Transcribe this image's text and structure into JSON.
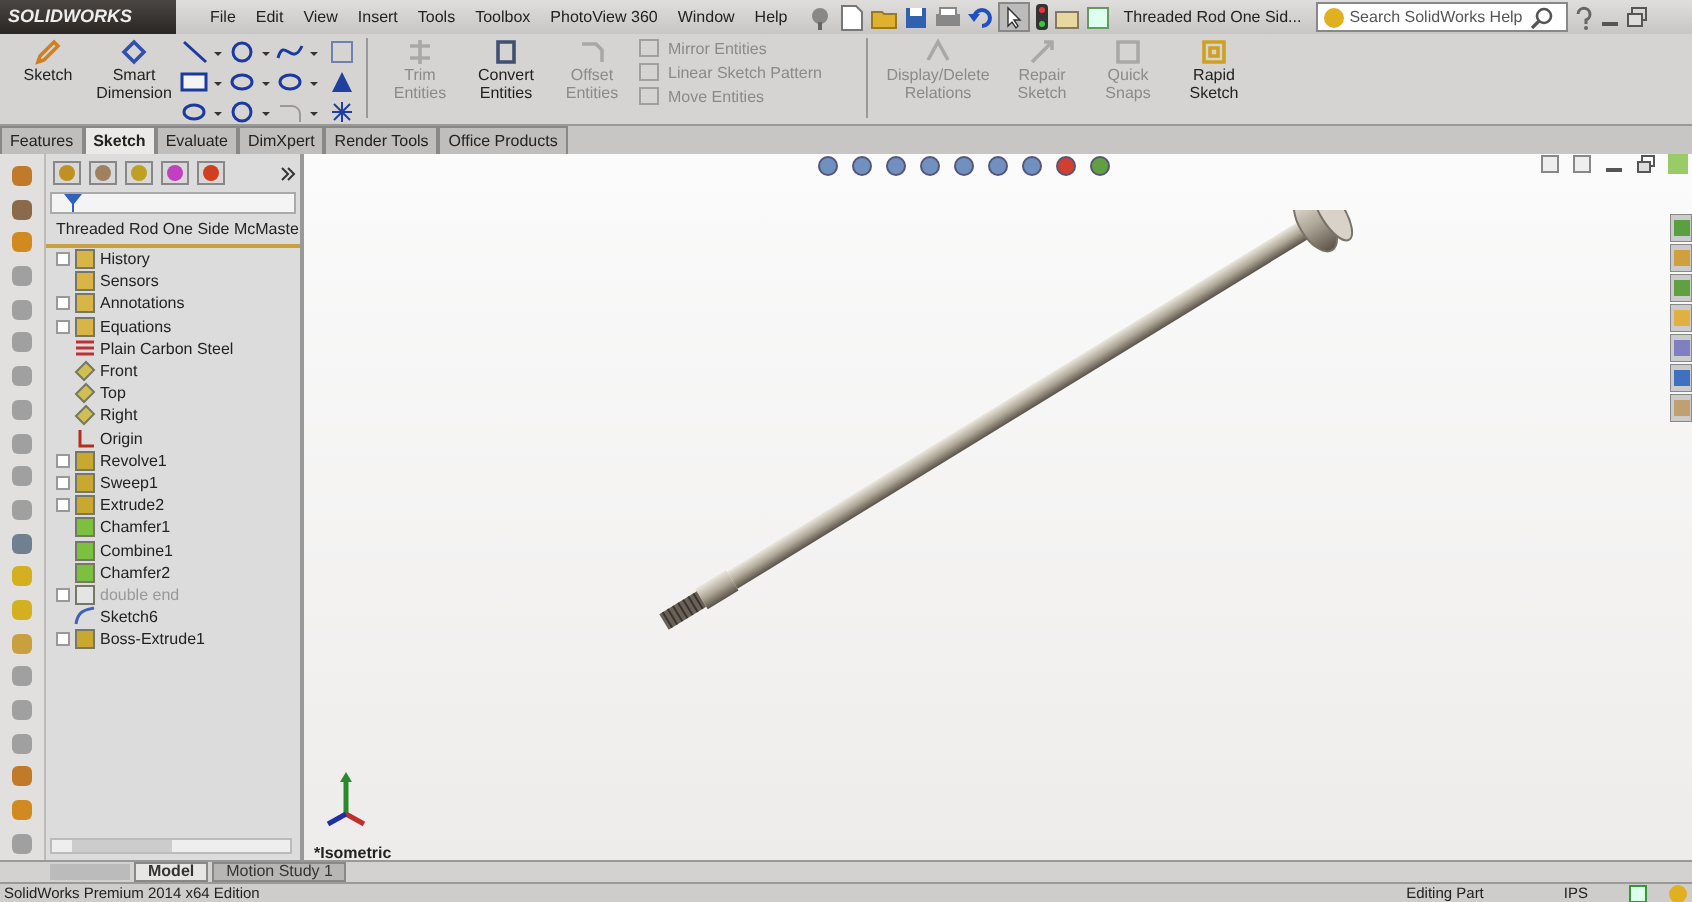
{
  "title_bar": {
    "logo": "SOLIDWORKS",
    "menu": [
      "File",
      "Edit",
      "View",
      "Insert",
      "Tools",
      "Toolbox",
      "PhotoView 360",
      "Window",
      "Help"
    ],
    "document_title": "Threaded Rod One Sid...",
    "search": {
      "placeholder": "Search SolidWorks Help"
    }
  },
  "command_manager": {
    "large_buttons": [
      {
        "label": "Sketch",
        "kind": "sketch",
        "disabled": false
      },
      {
        "label": "Smart Dimension",
        "kind": "dimension",
        "disabled": false
      }
    ],
    "entity_buttons": [
      {
        "label": "Trim Entities",
        "kind": "trim",
        "disabled": true
      },
      {
        "label": "Convert Entities",
        "kind": "convert",
        "disabled": false
      },
      {
        "label": "Offset Entities",
        "kind": "offset",
        "disabled": true
      }
    ],
    "small_buttons": [
      {
        "label": "Mirror Entities",
        "disabled": true
      },
      {
        "label": "Linear Sketch Pattern",
        "disabled": true
      },
      {
        "label": "Move Entities",
        "disabled": true
      }
    ],
    "right_buttons": [
      {
        "label": "Display/Delete Relations",
        "kind": "relations",
        "disabled": true
      },
      {
        "label": "Repair Sketch",
        "kind": "repair",
        "disabled": true
      },
      {
        "label": "Quick Snaps",
        "kind": "snaps",
        "disabled": true
      },
      {
        "label": "Rapid Sketch",
        "kind": "rapid",
        "disabled": false
      }
    ]
  },
  "tabs": [
    {
      "label": "Features",
      "selected": false
    },
    {
      "label": "Sketch",
      "selected": true
    },
    {
      "label": "Evaluate",
      "selected": false
    },
    {
      "label": "DimXpert",
      "selected": false
    },
    {
      "label": "Render Tools",
      "selected": false
    },
    {
      "label": "Office Products",
      "selected": false
    }
  ],
  "feature_tree": {
    "root": "Threaded Rod One Side McMaste",
    "items": [
      {
        "label": "History",
        "kind": "folder",
        "expandable": true,
        "suppressed": false
      },
      {
        "label": "Sensors",
        "kind": "folder",
        "expandable": false,
        "suppressed": false
      },
      {
        "label": "Annotations",
        "kind": "folder",
        "expandable": true,
        "suppressed": false
      },
      {
        "label": "Equations",
        "kind": "folder",
        "expandable": true,
        "suppressed": false
      },
      {
        "label": "Plain Carbon Steel",
        "kind": "material",
        "expandable": false,
        "suppressed": false
      },
      {
        "label": "Front",
        "kind": "plane",
        "expandable": false,
        "suppressed": false
      },
      {
        "label": "Top",
        "kind": "plane",
        "expandable": false,
        "suppressed": false
      },
      {
        "label": "Right",
        "kind": "plane",
        "expandable": false,
        "suppressed": false
      },
      {
        "label": "Origin",
        "kind": "origin",
        "expandable": false,
        "suppressed": false
      },
      {
        "label": "Revolve1",
        "kind": "feature",
        "expandable": true,
        "suppressed": false
      },
      {
        "label": "Sweep1",
        "kind": "feature",
        "expandable": true,
        "suppressed": false
      },
      {
        "label": "Extrude2",
        "kind": "feature",
        "expandable": true,
        "suppressed": false
      },
      {
        "label": "Chamfer1",
        "kind": "chamfer",
        "expandable": false,
        "suppressed": false
      },
      {
        "label": "Combine1",
        "kind": "chamfer",
        "expandable": false,
        "suppressed": false
      },
      {
        "label": "Chamfer2",
        "kind": "chamfer",
        "expandable": false,
        "suppressed": false
      },
      {
        "label": "double end",
        "kind": "feature",
        "expandable": true,
        "suppressed": true
      },
      {
        "label": "Sketch6",
        "kind": "sketch",
        "expandable": false,
        "suppressed": false
      },
      {
        "label": "Boss-Extrude1",
        "kind": "feature",
        "expandable": true,
        "suppressed": false
      }
    ]
  },
  "viewport": {
    "view_label": "*Isometric"
  },
  "bottom_tabs": [
    {
      "label": "Model",
      "selected": true
    },
    {
      "label": "Motion Study 1",
      "selected": false
    }
  ],
  "status_bar": {
    "edition": "SolidWorks Premium 2014 x64 Edition",
    "mode": "Editing Part",
    "units": "IPS"
  }
}
